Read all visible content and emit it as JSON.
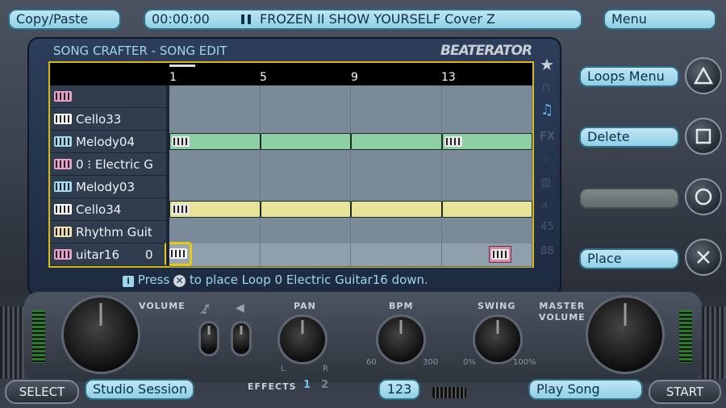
{
  "top_bar": {
    "copy_paste": "Copy/Paste",
    "time": "00:00:00",
    "now_playing_icon": "pause-icon",
    "song_title": "FROZEN II SHOW YOURSELF Cover Z",
    "menu": "Menu"
  },
  "panel": {
    "title": "SONG CRAFTER - SONG EDIT",
    "logo": "BEATERATOR",
    "timeline_markers": [
      "1",
      "5",
      "9",
      "13"
    ],
    "side_icons": [
      "star-icon",
      "headphones-icon",
      "music-note-icon",
      "fx-icon",
      "dots-icon",
      "bars-icon",
      "wave-icon",
      "tempo-icon",
      "mixer-icon"
    ],
    "tracks": [
      {
        "label": "",
        "icon_color": "#e8a0c8",
        "value": ""
      },
      {
        "label": "Cello33",
        "icon_color": "#ffffff",
        "value": ""
      },
      {
        "label": "Melody04",
        "icon_color": "#a0d8f0",
        "value": ""
      },
      {
        "label": "0 ⁝ Electric G",
        "icon_color": "#e8a0c8",
        "value": ""
      },
      {
        "label": "Melody03",
        "icon_color": "#a0d8f0",
        "value": ""
      },
      {
        "label": "Cello34",
        "icon_color": "#ffffff",
        "value": ""
      },
      {
        "label": "Rhythm Guit",
        "icon_color": "#f0e0b0",
        "value": ""
      },
      {
        "label": "uitar16",
        "icon_color": "#e8a0c8",
        "value": "0"
      }
    ],
    "track_number": "8",
    "hint_icon": "info-icon",
    "hint_prefix": "Press",
    "hint_button_icon": "cross-button-icon",
    "hint_text": "to place Loop 0   Electric Guitar16 down."
  },
  "right_menu": {
    "loops_menu": "Loops Menu",
    "delete": "Delete",
    "blank": "",
    "place": "Place",
    "triangle_icon": "triangle-button-icon",
    "square_icon": "square-button-icon",
    "circle_icon": "circle-button-icon",
    "cross_icon": "cross-button-icon"
  },
  "controls": {
    "volume_label": "VOLUME",
    "mute_icon": "mute-icon",
    "speaker_icon": "speaker-icon",
    "pan_label": "PAN",
    "pan_l": "L",
    "pan_r": "R",
    "effects_label": "EFFECTS",
    "effects_1": "1",
    "effects_2": "2",
    "bpm_label": "BPM",
    "bpm_min": "60",
    "bpm_max": "300",
    "swing_label": "SWING",
    "swing_min": "0%",
    "swing_max": "100%",
    "master_volume_label": "MASTER\nVOLUME"
  },
  "bottom_bar": {
    "select": "SELECT",
    "studio_session": "Studio Session",
    "bpm_value": "123",
    "play_song": "Play Song",
    "start": "START"
  },
  "colors": {
    "accent_cyan": "#9fd7ea",
    "grid_border": "#d6b81a",
    "loop_green": "#8fcfa6",
    "loop_yellow": "#e8e39a",
    "loop_pink": "#d38aa8"
  }
}
